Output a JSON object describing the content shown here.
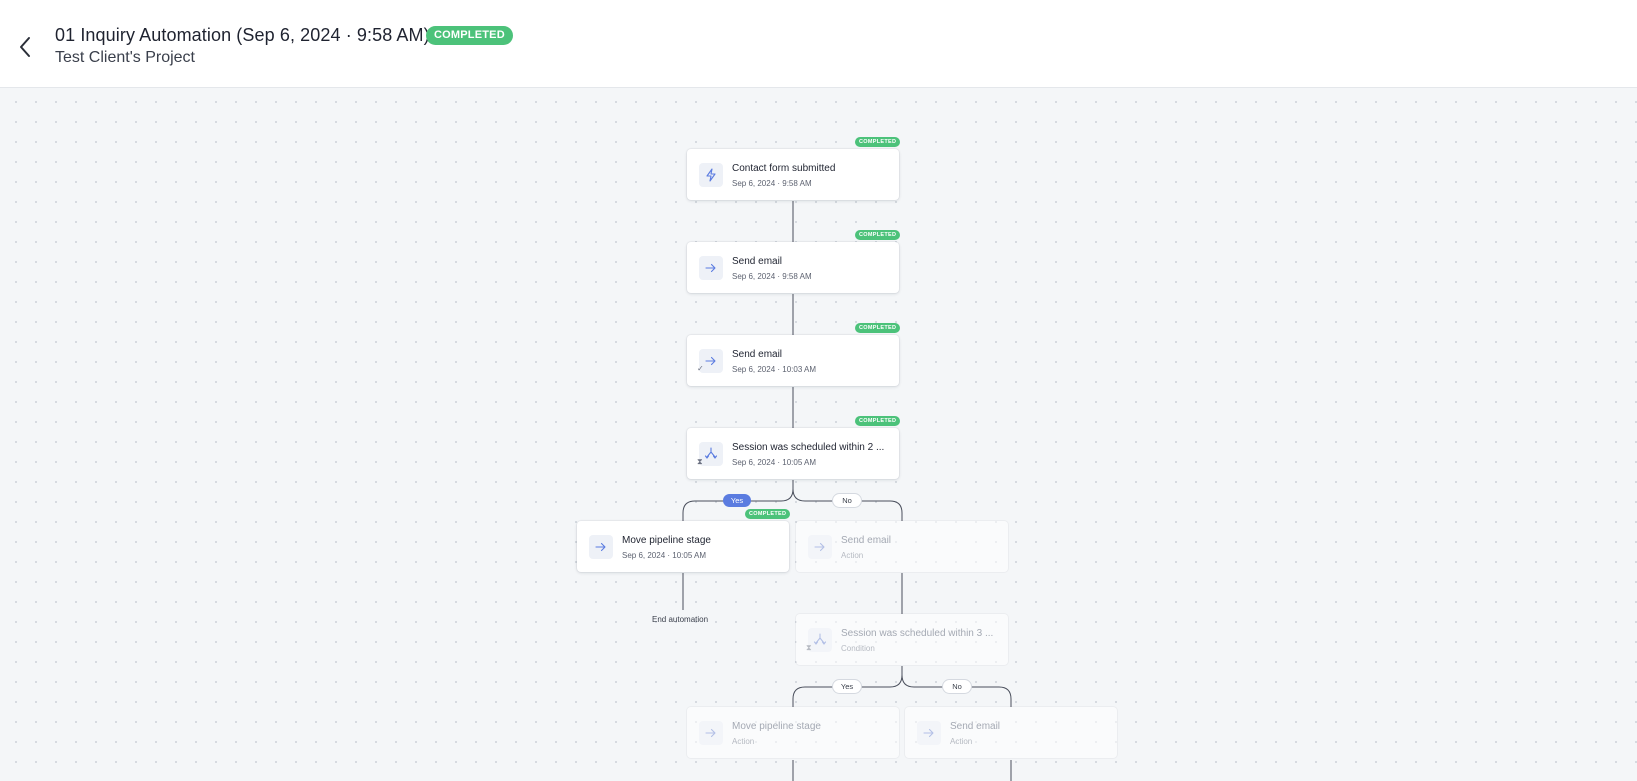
{
  "header": {
    "title": "01 Inquiry Automation (Sep 6, 2024 · 9:58 AM)",
    "status": "COMPLETED",
    "subtitle": "Test Client's Project",
    "status_color": "#4cc27a"
  },
  "flow": {
    "nodes": [
      {
        "title": "Contact form submitted",
        "subtitle": "Sep 6, 2024 · 9:58 AM",
        "badge": "COMPLETED",
        "icon": "lightning-icon"
      },
      {
        "title": "Send email",
        "subtitle": "Sep 6, 2024 · 9:58 AM",
        "badge": "COMPLETED",
        "icon": "arrow-right-icon"
      },
      {
        "title": "Send email",
        "subtitle": "Sep 6, 2024 · 10:03 AM",
        "badge": "COMPLETED",
        "icon": "arrow-right-icon",
        "mini": "✓"
      },
      {
        "title": "Session was scheduled within 2 ...",
        "subtitle": "Sep 6, 2024 · 10:05 AM",
        "badge": "COMPLETED",
        "icon": "branch-icon",
        "mini": "⧗"
      },
      {
        "title": "Move pipeline stage",
        "subtitle": "Sep 6, 2024 · 10:05 AM",
        "badge": "COMPLETED",
        "icon": "arrow-right-icon"
      },
      {
        "title": "Send email",
        "subtitle": "Action",
        "icon": "arrow-right-icon"
      },
      {
        "title": "Session was scheduled within 3 ...",
        "subtitle": "Condition",
        "icon": "branch-icon",
        "mini": "⧗"
      },
      {
        "title": "Move pipeline stage",
        "subtitle": "Action",
        "icon": "arrow-right-icon"
      },
      {
        "title": "Send email",
        "subtitle": "Action",
        "icon": "arrow-right-icon"
      }
    ],
    "branches": {
      "first_yes": "Yes",
      "first_no": "No",
      "second_yes": "Yes",
      "second_no": "No"
    },
    "end_label": "End automation",
    "accent_color": "#5b7ce0"
  }
}
